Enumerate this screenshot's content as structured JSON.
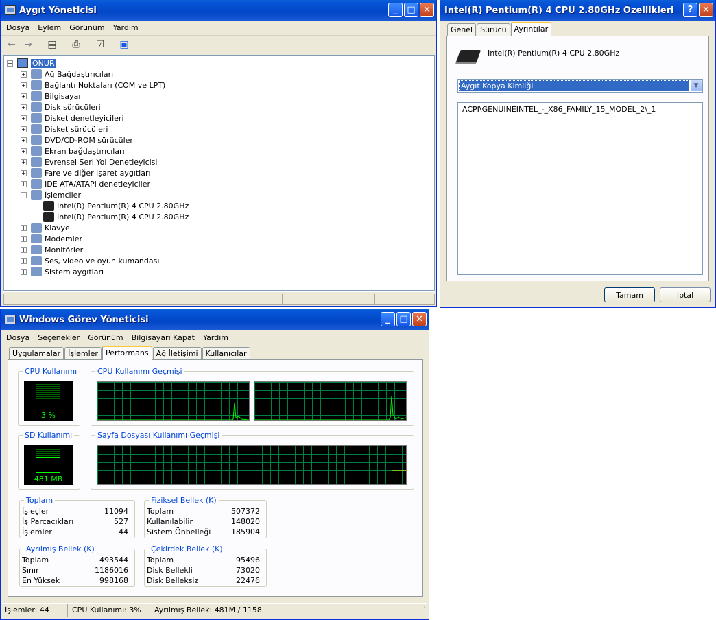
{
  "device_manager": {
    "title": "Aygıt Yöneticisi",
    "menu": [
      "Dosya",
      "Eylem",
      "Görünüm",
      "Yardım"
    ],
    "tree_root": "ONUR",
    "tree": [
      {
        "label": "Ağ Bağdaştırıcıları",
        "expanded": false
      },
      {
        "label": "Bağlantı Noktaları (COM ve LPT)",
        "expanded": false
      },
      {
        "label": "Bilgisayar",
        "expanded": false
      },
      {
        "label": "Disk sürücüleri",
        "expanded": false
      },
      {
        "label": "Disket denetleyicileri",
        "expanded": false
      },
      {
        "label": "Disket sürücüleri",
        "expanded": false
      },
      {
        "label": "DVD/CD-ROM sürücüleri",
        "expanded": false
      },
      {
        "label": "Ekran bağdaştırıcıları",
        "expanded": false
      },
      {
        "label": "Evrensel Seri Yol Denetleyicisi",
        "expanded": false
      },
      {
        "label": "Fare ve diğer işaret aygıtları",
        "expanded": false
      },
      {
        "label": "IDE ATA/ATAPI denetleyiciler",
        "expanded": false
      },
      {
        "label": "İşlemciler",
        "expanded": true
      },
      {
        "label": "Intel(R) Pentium(R) 4 CPU 2.80GHz",
        "child": true
      },
      {
        "label": "Intel(R) Pentium(R) 4 CPU 2.80GHz",
        "child": true
      },
      {
        "label": "Klavye",
        "expanded": false
      },
      {
        "label": "Modemler",
        "expanded": false
      },
      {
        "label": "Monitörler",
        "expanded": false
      },
      {
        "label": "Ses, video ve oyun kumandası",
        "expanded": false
      },
      {
        "label": "Sistem aygıtları",
        "expanded": false
      }
    ]
  },
  "properties": {
    "title": "Intel(R) Pentium(R) 4 CPU 2.80GHz Özellikleri",
    "tabs": [
      "Genel",
      "Sürücü",
      "Ayrıntılar"
    ],
    "active_tab": "Ayrıntılar",
    "device_name": "Intel(R) Pentium(R) 4 CPU 2.80GHz",
    "property_select": "Aygıt Kopya Kimliği",
    "value": "ACPI\\GENUINEINTEL_-_X86_FAMILY_15_MODEL_2\\_1",
    "ok": "Tamam",
    "cancel": "İptal"
  },
  "task_manager": {
    "title": "Windows Görev Yöneticisi",
    "menu": [
      "Dosya",
      "Seçenekler",
      "Görünüm",
      "Bilgisayarı Kapat",
      "Yardım"
    ],
    "tabs": [
      "Uygulamalar",
      "İşlemler",
      "Performans",
      "Ağ İletişimi",
      "Kullanıcılar"
    ],
    "active_tab": "Performans",
    "cpu_usage_label": "CPU Kullanımı",
    "cpu_usage_value": "3 %",
    "cpu_usage_percent": 3,
    "cpu_history_label": "CPU Kullanımı Geçmişi",
    "pf_usage_label": "SD Kullanımı",
    "pf_usage_value": "481 MB",
    "pf_history_label": "Sayfa Dosyası Kullanımı Geçmişi",
    "totals": {
      "label": "Toplam",
      "rows": [
        [
          "İşleçler",
          "11094"
        ],
        [
          "İş Parçacıkları",
          "527"
        ],
        [
          "İşlemler",
          "44"
        ]
      ]
    },
    "physical": {
      "label": "Fiziksel Bellek (K)",
      "rows": [
        [
          "Toplam",
          "507372"
        ],
        [
          "Kullanılabilir",
          "148020"
        ],
        [
          "Sistem Önbelleği",
          "185904"
        ]
      ]
    },
    "commit": {
      "label": "Ayrılmış Bellek (K)",
      "rows": [
        [
          "Toplam",
          "493544"
        ],
        [
          "Sınır",
          "1186016"
        ],
        [
          "En Yüksek",
          "998168"
        ]
      ]
    },
    "kernel": {
      "label": "Çekirdek Bellek (K)",
      "rows": [
        [
          "Toplam",
          "95496"
        ],
        [
          "Disk Bellekli",
          "73020"
        ],
        [
          "Disk Belleksiz",
          "22476"
        ]
      ]
    },
    "status": [
      "İşlemler: 44",
      "CPU Kullanımı: 3%",
      "Ayrılmış Bellek: 481M / 1158"
    ]
  },
  "colors": {
    "graph_line": "#00ff00",
    "graph_grid": "#008040",
    "title_blue": "#0046d5"
  }
}
